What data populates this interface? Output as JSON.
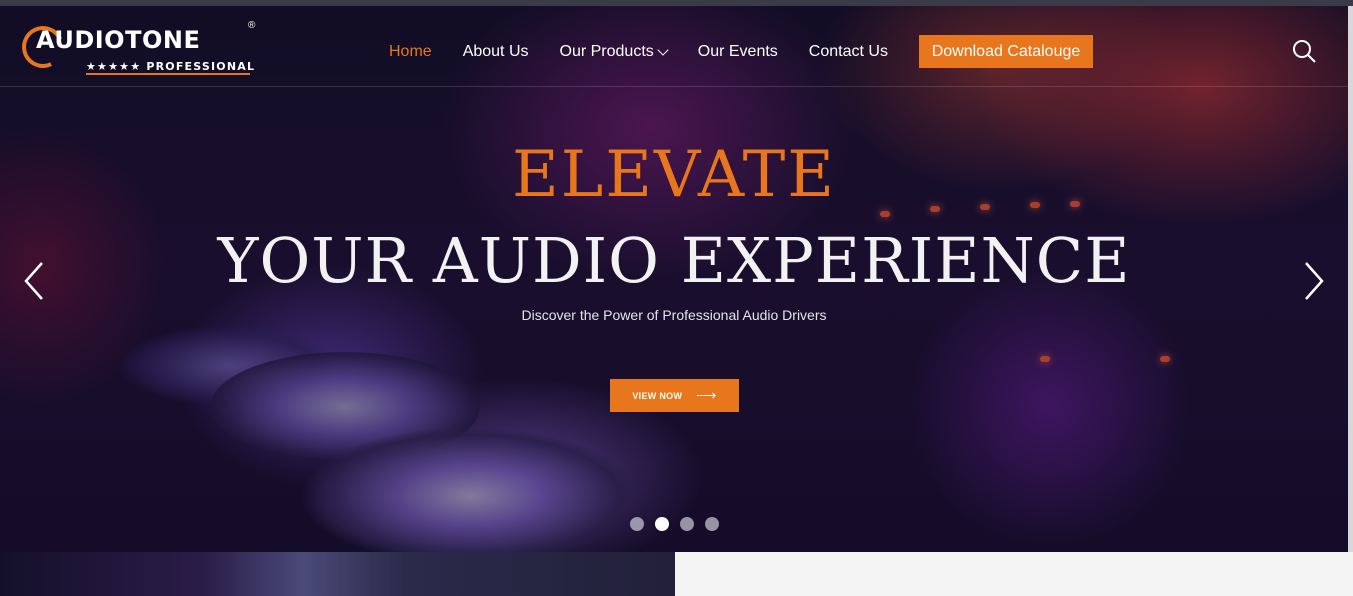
{
  "brand": {
    "name": "AUDIOTONE",
    "registered": "®",
    "tagline": "★★★★★ PROFESSIONAL",
    "accent_color": "#e8761c"
  },
  "nav": {
    "items": [
      {
        "label": "Home",
        "active": true
      },
      {
        "label": "About Us",
        "active": false
      },
      {
        "label": "Our Products",
        "active": false,
        "dropdown": true
      },
      {
        "label": "Our Events",
        "active": false
      },
      {
        "label": "Contact Us",
        "active": false
      }
    ],
    "download_label": "Download Catalouge",
    "search_icon": "search-icon"
  },
  "hero": {
    "headline_top": "ELEVATE",
    "headline_bottom": "YOUR AUDIO EXPERIENCE",
    "subtitle": "Discover the Power of Professional Audio Drivers",
    "cta_label": "VIEW NOW",
    "cta_arrow": "⟶",
    "slides_total": 4,
    "active_slide": 2
  }
}
